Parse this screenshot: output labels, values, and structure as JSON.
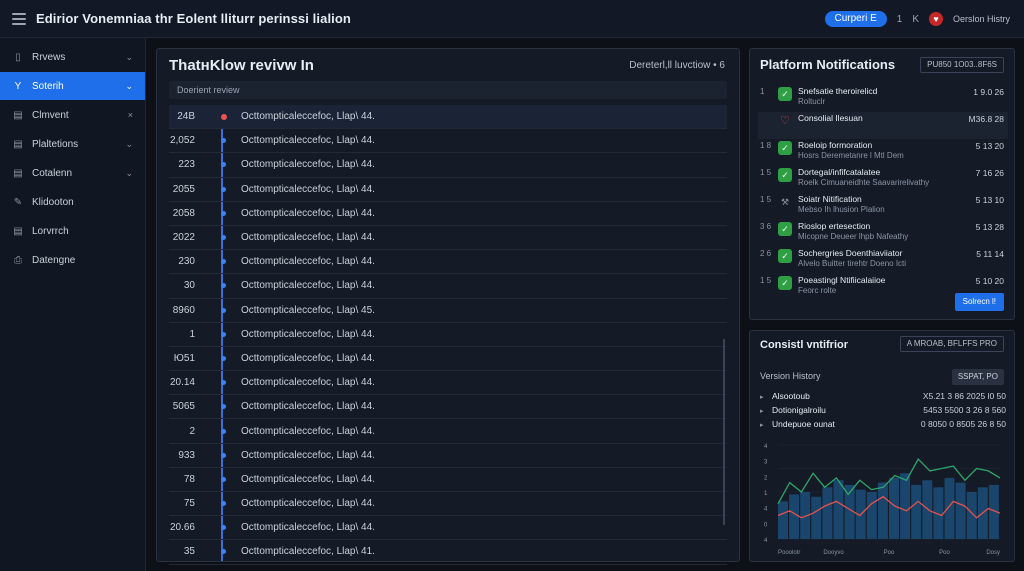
{
  "topbar": {
    "title": "Edirior Vonemniaa thr Eolent lliturr perinssi lialion",
    "pill": "Curperi E",
    "small1": "1",
    "small2": "K",
    "link": "Oerslon Histry"
  },
  "sidebar": {
    "items": [
      {
        "label": "Rrvews",
        "icon": "▯",
        "chev": "⌄",
        "active": false
      },
      {
        "label": "Soterih",
        "icon": "Y",
        "chev": "⌄",
        "active": true
      },
      {
        "label": "Clmvent",
        "icon": "▤",
        "chev": "×",
        "active": false
      },
      {
        "label": "Plaltetions",
        "icon": "▤",
        "chev": "⌄",
        "active": false
      },
      {
        "label": "Cotalenn",
        "icon": "▤",
        "chev": "⌄",
        "active": false
      },
      {
        "label": "Klidooton",
        "icon": "✎",
        "chev": "",
        "active": false
      },
      {
        "label": "Lorvrrch",
        "icon": "▤",
        "chev": "",
        "active": false
      },
      {
        "label": "Datengne",
        "icon": "⎙",
        "chev": "",
        "active": false
      }
    ]
  },
  "main": {
    "title": "ThatнKlow revivw  In",
    "meta": "Dereterl,ll luvctiow •  6",
    "sub": "Doerient review",
    "rows": [
      {
        "num": "24B",
        "text": "Octtompticaleccefoc, Llap\\ 44.",
        "selected": true
      },
      {
        "num": "2,052",
        "text": "Octtompticaleccefoc, Llap\\ 44.",
        "selected": false
      },
      {
        "num": "223",
        "text": "Octtompticaleccefoc, Llap\\ 44.",
        "selected": false
      },
      {
        "num": "2055",
        "text": "Octtompticaleccefoc, Llap\\ 44.",
        "selected": false
      },
      {
        "num": "2058",
        "text": "Octtompticaleccefoc, Llap\\ 44.",
        "selected": false
      },
      {
        "num": "2022",
        "text": "Octtompticaleccefoc, Llap\\ 44.",
        "selected": false
      },
      {
        "num": "230",
        "text": "Octtompticaleccefoc, Llap\\ 44.",
        "selected": false
      },
      {
        "num": "30",
        "text": "Octtompticaleccefoc, Llap\\ 44.",
        "selected": false
      },
      {
        "num": "8960",
        "text": "Octtompticaleccefoc, Llap\\ 45.",
        "selected": false
      },
      {
        "num": "1",
        "text": "Octtompticaleccefoc, Llap\\ 44.",
        "selected": false
      },
      {
        "num": "Ю51",
        "text": "Octtompticaleccefoc, Llap\\ 44.",
        "selected": false
      },
      {
        "num": "20.14",
        "text": "Octtompticaleccefoc, Llap\\ 44.",
        "selected": false
      },
      {
        "num": "5065",
        "text": "Octtompticaleccefoc, Llap\\ 44.",
        "selected": false
      },
      {
        "num": "2",
        "text": "Octtompticaleccefoc, Llap\\ 44.",
        "selected": false
      },
      {
        "num": "933",
        "text": "Octtompticaleccefoc, Llap\\ 44.",
        "selected": false
      },
      {
        "num": "78",
        "text": "Octtompticaleccefoc, Llap\\ 44.",
        "selected": false
      },
      {
        "num": "75",
        "text": "Octtompticaleccefoc, Llap\\ 44.",
        "selected": false
      },
      {
        "num": "20.66",
        "text": "Octtompticaleccefoc, Llap\\ 44.",
        "selected": false
      },
      {
        "num": "35",
        "text": "Octtompticaleccefoc, Llap\\ 41.",
        "selected": false
      }
    ]
  },
  "notifications": {
    "title": "Platform Notifications",
    "badge": "PU850 1O03..8F6S",
    "items": [
      {
        "left": "1",
        "icon": "check",
        "title": "Snefsatie theroirelicd",
        "sub": "Roltuclr",
        "time": "1 9.0 26"
      },
      {
        "left": "",
        "icon": "heart",
        "title": "Consolial Ilesuan",
        "sub": "",
        "time": "M36.8 28",
        "hl": true
      },
      {
        "left": "1 8",
        "icon": "check",
        "title": "Roeloip formoration",
        "sub": "Hosrs  Deremetanre  l Mtl Dem",
        "time": "5 13 20"
      },
      {
        "left": "1 5",
        "icon": "check",
        "title": "Dortegal/infifcatalatee",
        "sub": "Roelk  Cimuaneidhte  Saavarirelivathy",
        "time": "7 16 26"
      },
      {
        "left": "1 5",
        "icon": "tool",
        "title": "Soiatr Nitification",
        "sub": "Mebso Ih lhusion Plalion",
        "time": "5 13 10"
      },
      {
        "left": "3 6",
        "icon": "check",
        "title": "Rioslop ertesection",
        "sub": "Micopne  Deueer  lhpb Nafeathy",
        "time": "5 13 28"
      },
      {
        "left": "2 6",
        "icon": "check",
        "title": "Sochergries  Doenthiaviiator",
        "sub": "Alvelo  Buitter  tirehtr   Doeno Icti",
        "time": "5 11 14"
      },
      {
        "left": "1 5",
        "icon": "check",
        "title": "Poeastingl Ntifiicalaiioe",
        "sub": "Feorc  rolte",
        "time": "5 10 20"
      }
    ],
    "button": "Solrecn  l!"
  },
  "history": {
    "title": "Consistl vntifrior",
    "badge": "A MROAB, BFLFFS PRO",
    "sub": "Version History",
    "subbtn": "SSPAT, PO",
    "rows": [
      {
        "label": "Alsootoub",
        "value": "X5.21 3 86 2025 l0 50"
      },
      {
        "label": "Dotionigalroilu",
        "value": "5453 5500 3 26 8 560"
      },
      {
        "label": "Undepuoe ounat",
        "value": "0 8050 0 8505 26 8 50"
      }
    ],
    "chart_xlabels": [
      "Pooolotr",
      "Dooyvo",
      "Poo",
      "Poo",
      "Dosy"
    ],
    "chart_ylabels": [
      "4",
      "3",
      "2",
      "1",
      "4",
      "0",
      "4"
    ]
  },
  "chart_data": {
    "type": "line",
    "x": [
      0,
      1,
      2,
      3,
      4,
      5,
      6,
      7,
      8,
      9,
      10,
      11,
      12,
      13,
      14,
      15,
      16,
      17,
      18,
      19
    ],
    "series": [
      {
        "values": [
          1.5,
          2.4,
          2.0,
          2.8,
          2.2,
          2.6,
          1.9,
          2.5,
          2.1,
          2.2,
          2.7,
          2.5,
          3.4,
          2.9,
          3.0,
          3.1,
          2.5,
          3.0,
          2.9,
          2.6
        ]
      },
      {
        "values": [
          1.0,
          1.2,
          0.9,
          1.1,
          1.4,
          1.6,
          1.3,
          1.0,
          1.5,
          1.8,
          1.4,
          1.2,
          1.6,
          1.2,
          1.0,
          1.6,
          1.4,
          0.9,
          1.3,
          1.1
        ]
      }
    ],
    "bars": [
      1.6,
      1.9,
      2.0,
      1.8,
      2.2,
      2.5,
      2.3,
      2.1,
      2.0,
      2.4,
      2.6,
      2.8,
      2.3,
      2.5,
      2.2,
      2.6,
      2.4,
      2.0,
      2.2,
      2.3
    ],
    "ylim": [
      0,
      4
    ]
  },
  "colors": {
    "accent": "#1f6feb",
    "check": "#2ea043",
    "line1": "#2ea66b",
    "line2": "#e5534b",
    "bars": "#1b4d7a"
  }
}
